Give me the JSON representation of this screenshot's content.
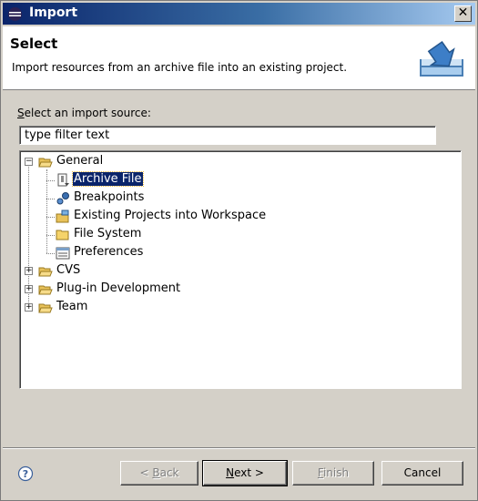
{
  "window": {
    "title": "Import"
  },
  "header": {
    "title": "Select",
    "description": "Import resources from an archive file into an existing project."
  },
  "source": {
    "label_first": "S",
    "label_rest": "elect an import source:",
    "filter_value": "type filter text"
  },
  "tree": {
    "general": {
      "label": "General",
      "expanded": true
    },
    "children": [
      {
        "label": "Archive File",
        "selected": true,
        "icon": "archive-file-icon"
      },
      {
        "label": "Breakpoints",
        "icon": "breakpoints-icon"
      },
      {
        "label": "Existing Projects into Workspace",
        "icon": "project-icon"
      },
      {
        "label": "File System",
        "icon": "folder-icon"
      },
      {
        "label": "Preferences",
        "icon": "preferences-icon"
      }
    ],
    "cvs": {
      "label": "CVS",
      "expanded": false
    },
    "plugin": {
      "label": "Plug-in Development",
      "expanded": false
    },
    "team": {
      "label": "Team",
      "expanded": false
    }
  },
  "buttons": {
    "back": {
      "prefix": "< ",
      "mnemonic": "B",
      "rest": "ack",
      "enabled": false
    },
    "next": {
      "mnemonic": "N",
      "rest": "ext >",
      "enabled": true
    },
    "finish": {
      "mnemonic": "F",
      "rest": "inish",
      "enabled": false
    },
    "cancel": {
      "label": "Cancel",
      "enabled": true
    }
  },
  "colors": {
    "selection": "#0a246a",
    "titlebar_start": "#0a246a",
    "titlebar_end": "#a6caf0",
    "dialog_bg": "#d4d0c8"
  }
}
